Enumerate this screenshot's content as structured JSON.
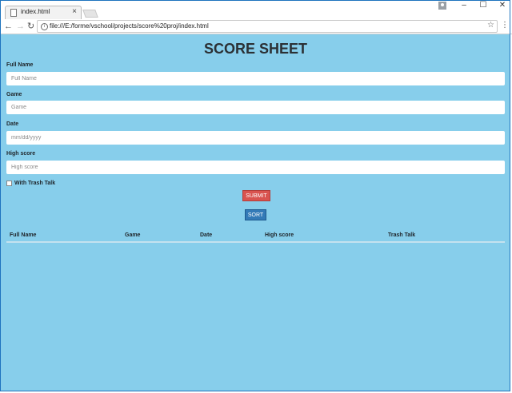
{
  "browser": {
    "tab_title": "index.html",
    "tab_close": "×",
    "url": "file:///E:/forme/vschool/projects/score%20proj/index.html",
    "window_controls": [
      "–",
      "☐",
      "✕"
    ]
  },
  "page": {
    "title": "SCORE SHEET",
    "fields": [
      {
        "label": "Full Name",
        "placeholder": "Full Name"
      },
      {
        "label": "Game",
        "placeholder": "Game"
      },
      {
        "label": "Date",
        "placeholder": "mm/dd/yyyy"
      },
      {
        "label": "High score",
        "placeholder": "High score"
      }
    ],
    "checkbox_label": "With Trash Talk",
    "submit_label": "SUBMIT",
    "sort_label": "SORT",
    "table_headers": [
      "Full Name",
      "Game",
      "Date",
      "High score",
      "Trash Talk"
    ]
  },
  "colors": {
    "page_background": "#87ceeb",
    "submit_button": "#d9534f",
    "sort_button": "#337ab7",
    "title_text": "#2b3034"
  }
}
